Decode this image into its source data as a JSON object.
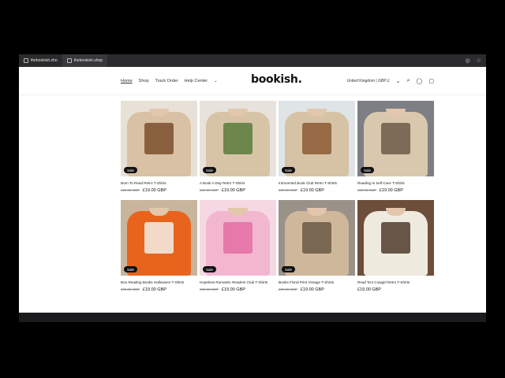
{
  "browser": {
    "tab1": "thebookish.sho",
    "tab2": "thebookish.shop"
  },
  "header": {
    "nav": [
      "Home",
      "Shop",
      "Track Order",
      "Help Center"
    ],
    "logo": "bookish.",
    "region": "United Kingdom | GBP £"
  },
  "products": [
    {
      "title": "Born To Read Retro T-Shirts",
      "old_price": "£29.00 GBP",
      "price": "£19.00 GBP",
      "sale": "Sale",
      "shirt_color": "#d8c1a4",
      "bg": "#e8e1d8",
      "print_color": "#7b4f2d"
    },
    {
      "title": "A Book A Day Retro T-Shirts",
      "old_price": "£29.00 GBP",
      "price": "£19.00 GBP",
      "sale": "Sale",
      "shirt_color": "#d7c4a7",
      "bg": "#e7e2dc",
      "print_color": "#5a7b3c"
    },
    {
      "title": "Introverted Book Club Retro T-Shirts",
      "old_price": "£29.00 GBP",
      "price": "£19.00 GBP",
      "sale": "Sale",
      "shirt_color": "#d6c2a5",
      "bg": "#dfe4e6",
      "print_color": "#8b5a32"
    },
    {
      "title": "Reading Is Self-Care T-Shirts",
      "old_price": "£29.00 GBP",
      "price": "£19.00 GBP",
      "sale": "Sale",
      "shirt_color": "#d9c8ad",
      "bg": "#7d7f84",
      "print_color": "#6b5a48"
    },
    {
      "title": "Boo Reading Books Halloween T-Shirts",
      "old_price": "£29.00 GBP",
      "price": "£19.00 GBP",
      "sale": "Sale",
      "shirt_color": "#e8641c",
      "bg": "#c9b49e",
      "print_color": "#f2efe7"
    },
    {
      "title": "Hopeless Romantic Readers Club T-Shirts",
      "old_price": "£29.00 GBP",
      "price": "£19.00 GBP",
      "sale": "Sale",
      "shirt_color": "#f2b6cf",
      "bg": "#f5d8e2",
      "print_color": "#e46fa2"
    },
    {
      "title": "Books Floral Print Vintage T-Shirts",
      "old_price": "£29.00 GBP",
      "price": "£19.00 GBP",
      "sale": "Sale",
      "shirt_color": "#cfb79b",
      "bg": "#9a9289",
      "print_color": "#6c5b46"
    },
    {
      "title": "Read 'Em Cowgirl Retro T-Shirts",
      "old_price": "",
      "price": "£19.00 GBP",
      "sale": "",
      "shirt_color": "#efeade",
      "bg": "#6c4e3b",
      "print_color": "#4f3c2d"
    }
  ]
}
